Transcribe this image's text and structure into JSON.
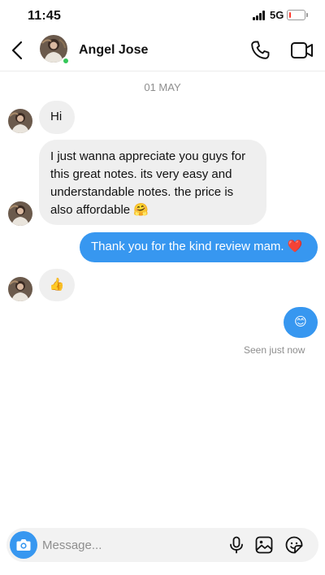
{
  "status_bar": {
    "time": "11:45",
    "network": "5G",
    "battery_level": 0.1
  },
  "header": {
    "contact_name": "Angel Jose",
    "online": true,
    "icons": {
      "back": "chevron-left-icon",
      "call": "phone-icon",
      "video": "video-camera-icon"
    }
  },
  "conversation": {
    "date_divider": "01 MAY",
    "messages": [
      {
        "direction": "incoming",
        "text": "Hi"
      },
      {
        "direction": "incoming",
        "lines": [
          "I just wanna appreciate you guys for",
          "this great notes. its very easy and",
          "understandable notes. the price is",
          "also affordable 🤗"
        ]
      },
      {
        "direction": "outgoing",
        "text": "Thank you for the kind review mam. ❤️"
      },
      {
        "direction": "incoming",
        "text": "👍"
      },
      {
        "direction": "outgoing",
        "text": "😊"
      }
    ],
    "seen_status": "Seen just now"
  },
  "composer": {
    "placeholder": "Message...",
    "icons": {
      "camera": "camera-icon",
      "mic": "microphone-icon",
      "gallery": "image-icon",
      "sticker": "sticker-icon"
    }
  },
  "colors": {
    "accent": "#3797f0",
    "incoming_bubble": "#efefef",
    "online": "#34c759",
    "muted_text": "#8e8e8e"
  }
}
